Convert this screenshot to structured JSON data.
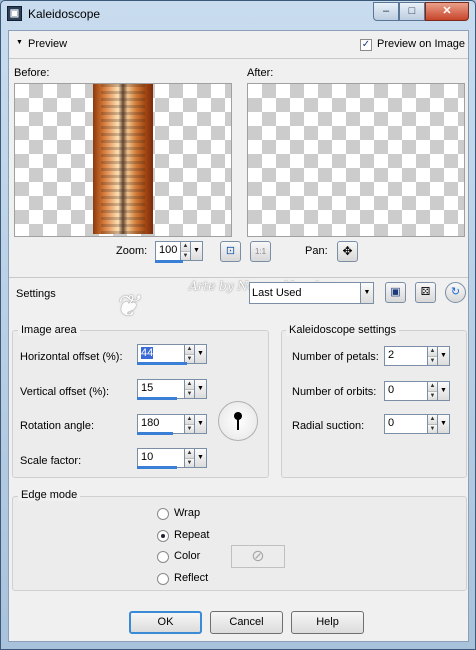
{
  "window": {
    "title": "Kaleidoscope",
    "app_icon": "PSP",
    "controls": {
      "minimize": "–",
      "maximize": "□",
      "close": "✕"
    }
  },
  "preview": {
    "toggle_label": "Preview",
    "preview_on_image_label": "Preview on Image",
    "preview_on_image_checked": true,
    "before_label": "Before:",
    "after_label": "After:",
    "zoom_label": "Zoom:",
    "zoom_value": "100",
    "zoom_fit_icon": "fit-window-icon",
    "zoom_actual_label": "1:1",
    "pan_label": "Pan:",
    "pan_icon": "move-icon"
  },
  "settings": {
    "label": "Settings",
    "preset_value": "Last Used",
    "watermark_text": "Arte by Norma Novales"
  },
  "image_area": {
    "title": "Image area",
    "horizontal_offset_label": "Horizontal offset (%):",
    "horizontal_offset_value": "44",
    "vertical_offset_label": "Vertical offset (%):",
    "vertical_offset_value": "15",
    "rotation_angle_label": "Rotation angle:",
    "rotation_angle_value": "180",
    "scale_factor_label": "Scale factor:",
    "scale_factor_value": "10"
  },
  "kaleidoscope_settings": {
    "title": "Kaleidoscope settings",
    "petals_label": "Number of petals:",
    "petals_value": "2",
    "orbits_label": "Number of orbits:",
    "orbits_value": "0",
    "radial_suction_label": "Radial suction:",
    "radial_suction_value": "0"
  },
  "edge_mode": {
    "title": "Edge mode",
    "options": [
      "Wrap",
      "Repeat",
      "Color",
      "Reflect"
    ],
    "selected": "Repeat"
  },
  "buttons": {
    "ok": "OK",
    "cancel": "Cancel",
    "help": "Help"
  }
}
